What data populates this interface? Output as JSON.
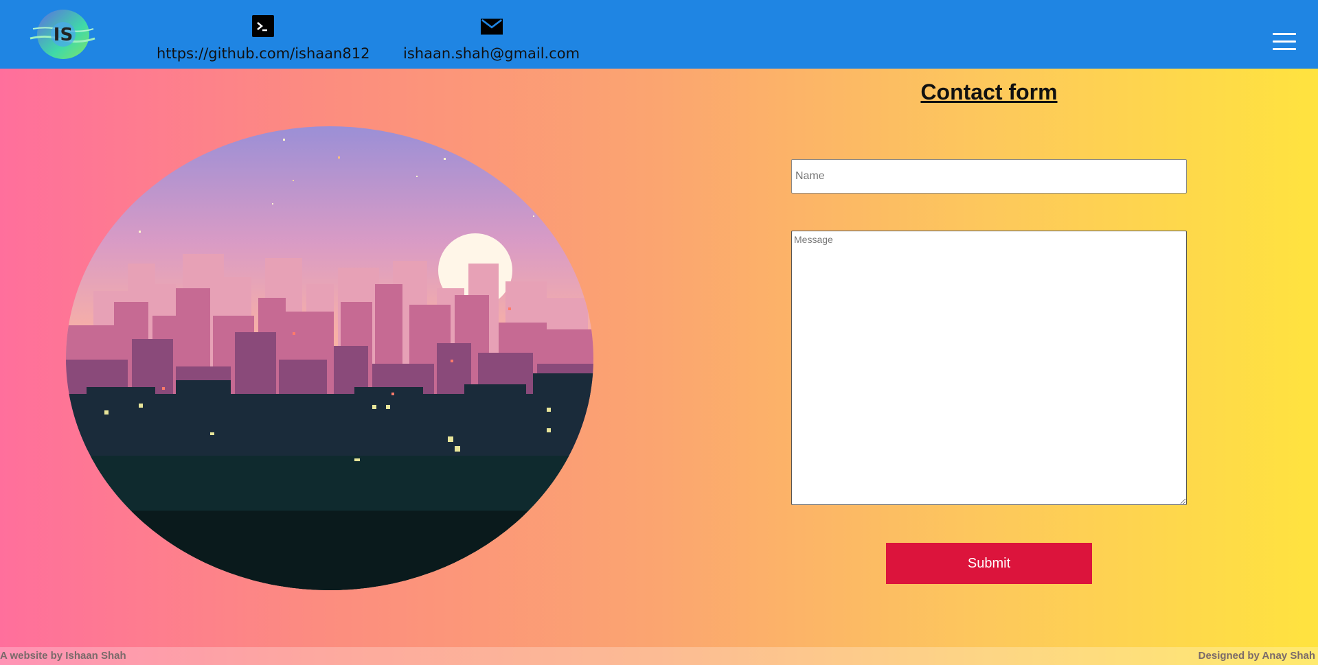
{
  "header": {
    "logo_text": "IS",
    "github": {
      "icon": "terminal-icon",
      "text": "https://github.com/ishaan812"
    },
    "email": {
      "icon": "mail-icon",
      "text": "ishaan.shah@gmail.com"
    },
    "menu_icon": "hamburger-menu-icon"
  },
  "hero_image": {
    "description": "pixel-art city skyline at sunset"
  },
  "form": {
    "title": "Contact form",
    "name_placeholder": "Name",
    "message_placeholder": "Message",
    "submit_label": "Submit"
  },
  "footer": {
    "left_text": "A website by Ishaan Shah",
    "right_text": "Designed by Anay Shah"
  },
  "colors": {
    "header_bg": "#1f85e3",
    "submit_bg": "#dc143c",
    "gradient_start": "#ff6f9c",
    "gradient_end": "#ffe33f"
  }
}
